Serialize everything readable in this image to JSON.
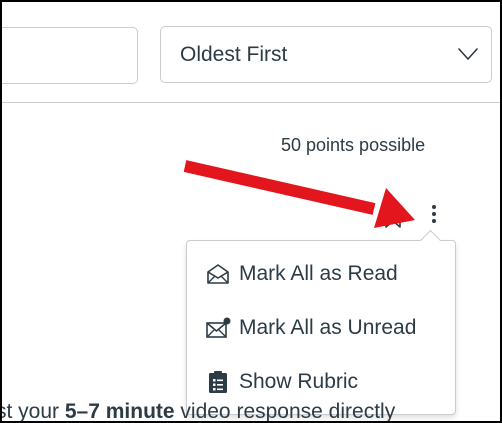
{
  "toolbar": {
    "sort_value": "Oldest First"
  },
  "assignment": {
    "points": "50 points possible"
  },
  "menu": {
    "items": [
      {
        "label": "Mark All as Read",
        "icon": "envelope-open-icon"
      },
      {
        "label": "Mark All as Unread",
        "icon": "envelope-unread-icon"
      },
      {
        "label": "Show Rubric",
        "icon": "clipboard-icon"
      }
    ]
  },
  "body": {
    "text_prefix": "st your ",
    "text_bold": "5–7 minute",
    "text_suffix": " video response directly"
  },
  "colors": {
    "annotation_arrow": "#e3161d",
    "text": "#2d3b45",
    "border": "#c7cdd1"
  }
}
